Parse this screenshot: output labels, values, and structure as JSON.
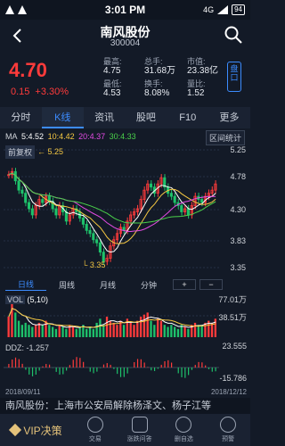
{
  "status_bar": {
    "time": "3:01 PM",
    "network": "4G",
    "battery": "94"
  },
  "header": {
    "title": "南风股份",
    "code": "300004"
  },
  "quote": {
    "price": "4.70",
    "change": "0.15",
    "change_pct": "+3.30%",
    "stats": [
      {
        "label": "最高:",
        "value": "4.75"
      },
      {
        "label": "最低:",
        "value": "4.53"
      },
      {
        "label": "总手:",
        "value": "31.68万"
      },
      {
        "label": "换手:",
        "value": "8.08%"
      },
      {
        "label": "市值:",
        "value": "23.38亿"
      },
      {
        "label": "量比:",
        "value": "1.52"
      }
    ],
    "pankou_label": "盘口"
  },
  "tabs": [
    "分时",
    "K线",
    "资讯",
    "股吧",
    "F10",
    "更多"
  ],
  "ma": {
    "title": "MA",
    "ma5": "5:4.52",
    "ma10": "10:4.42",
    "ma20": "20:4.37",
    "ma30": "30:4.33"
  },
  "interval_button": "区间统计",
  "adjust_button": "前复权",
  "kline": {
    "axis": [
      "5.25",
      "4.78",
      "4.30",
      "3.83",
      "3.35"
    ],
    "high_marker": "5.25",
    "low_marker": "3.35"
  },
  "period_tabs": [
    "日线",
    "周线",
    "月线",
    "分钟"
  ],
  "zoom_in": "+",
  "zoom_out": "−",
  "volume": {
    "label": "VOL",
    "ma": "(5,10)",
    "axis_top": "77.01万",
    "axis_mid": "38.51万"
  },
  "ddz": {
    "label": "DDZ: -1.257",
    "axis_top": "23.555",
    "axis_bottom": "-15.786"
  },
  "dates": {
    "start": "2018/09/11",
    "end": "2018/12/12"
  },
  "news": "南风股份：上海市公安局解除杨泽文、杨子江等",
  "bottom_bar": {
    "vip": "VIP决策",
    "items": [
      "交易",
      "涨跌问答",
      "删自选",
      "预警"
    ]
  },
  "colors": {
    "up": "#ff3b3b",
    "down": "#1ec26b",
    "ma5": "#ffffff",
    "ma10": "#f5c842",
    "ma20": "#e44be4",
    "ma30": "#4ad04a",
    "accent": "#3c8cff",
    "vip": "#e4c27a"
  }
}
